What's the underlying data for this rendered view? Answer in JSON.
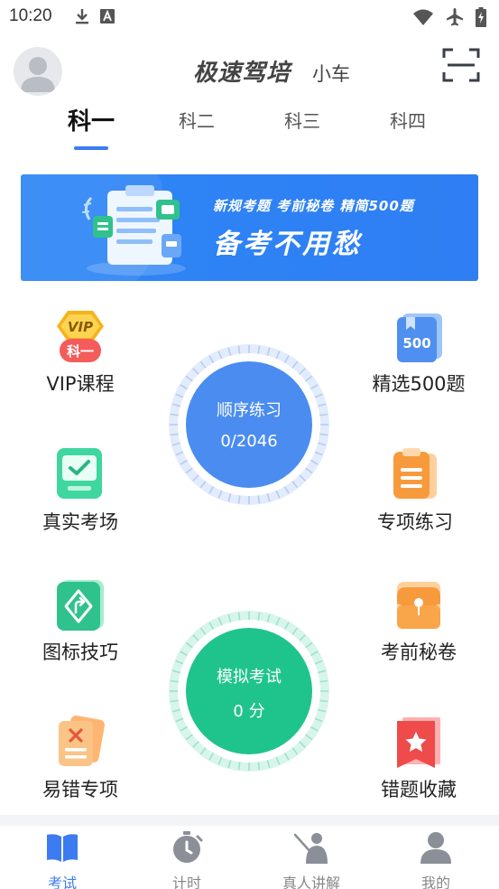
{
  "status_bar": {
    "time": "10:20",
    "left_icons": [
      "download-icon",
      "font-a-icon"
    ],
    "right_icons": [
      "wifi-icon",
      "airplane-icon",
      "battery-charging-icon"
    ]
  },
  "header": {
    "app_title": "极速驾培",
    "app_subtitle": "小车",
    "avatar_icon": "user-avatar-icon",
    "scan_icon": "scan-icon"
  },
  "tabs": [
    {
      "label": "科一",
      "active": true
    },
    {
      "label": "科二",
      "active": false
    },
    {
      "label": "科三",
      "active": false
    },
    {
      "label": "科四",
      "active": false
    }
  ],
  "banner": {
    "line1": "新规考题  考前秘卷  精简500题",
    "line2": "备考不用愁"
  },
  "features": {
    "vip": {
      "label": "VIP课程",
      "badge_text": "VIP",
      "badge_sub": "科一"
    },
    "select500": {
      "label": "精选500题",
      "icon_text": "500"
    },
    "real_exam": {
      "label": "真实考场"
    },
    "special": {
      "label": "专项练习"
    },
    "sign_tips": {
      "label": "图标技巧"
    },
    "secret": {
      "label": "考前秘卷"
    },
    "mistakes": {
      "label": "易错专项"
    },
    "wrong_collect": {
      "label": "错题收藏"
    }
  },
  "practice_circle": {
    "title": "顺序练习",
    "progress": "0/2046",
    "color": "#4a8cf0"
  },
  "mock_circle": {
    "title": "模拟考试",
    "score": "0 分",
    "color": "#1fc48c"
  },
  "bottom_nav": [
    {
      "label": "考试",
      "icon": "book-icon",
      "active": true
    },
    {
      "label": "计时",
      "icon": "stopwatch-icon",
      "active": false
    },
    {
      "label": "真人讲解",
      "icon": "teacher-icon",
      "active": false
    },
    {
      "label": "我的",
      "icon": "person-icon",
      "active": false
    }
  ],
  "colors": {
    "accent": "#3c7cf0",
    "banner": "#2d86f6"
  }
}
